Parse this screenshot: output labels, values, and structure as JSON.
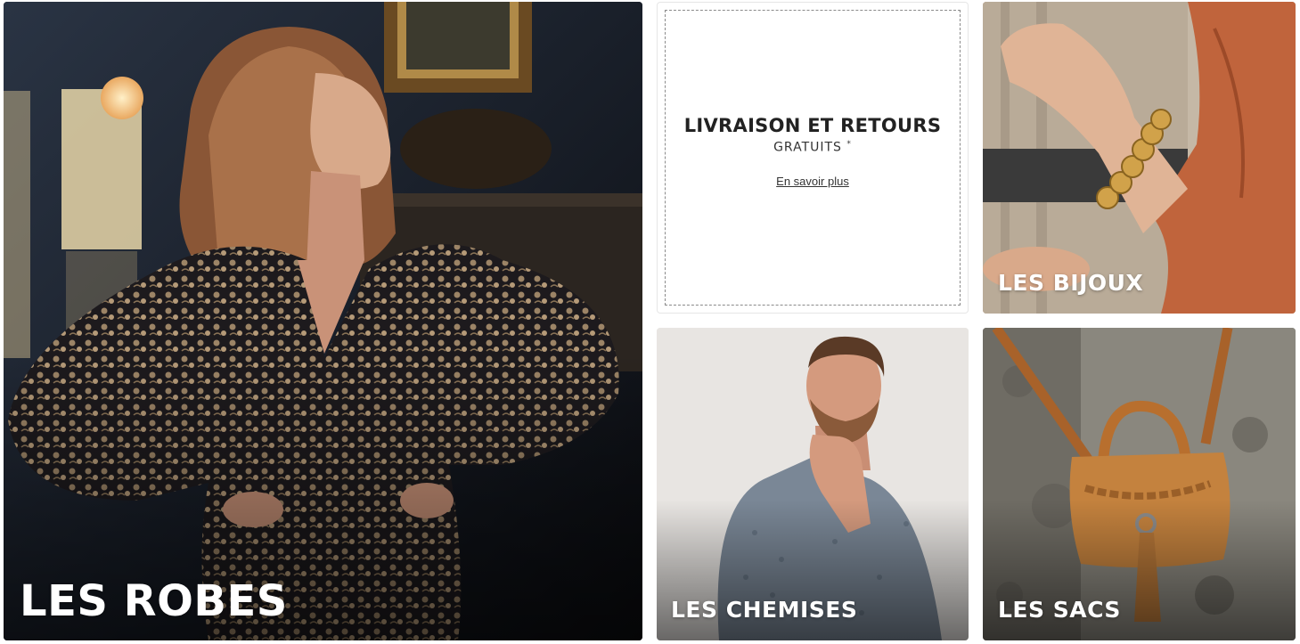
{
  "tiles": {
    "robes": {
      "label": "LES ROBES"
    },
    "promo": {
      "title": "LIVRAISON ET RETOURS",
      "subtitle": "GRATUITS",
      "asterisk": "*",
      "link": "En savoir plus"
    },
    "bijoux": {
      "label": "LES BIJOUX"
    },
    "chemises": {
      "label": "LES CHEMISES"
    },
    "sacs": {
      "label": "LES SACS"
    }
  },
  "colors": {
    "label_text": "#ffffff",
    "promo_border": "#8a8a8a",
    "promo_text": "#222222"
  }
}
